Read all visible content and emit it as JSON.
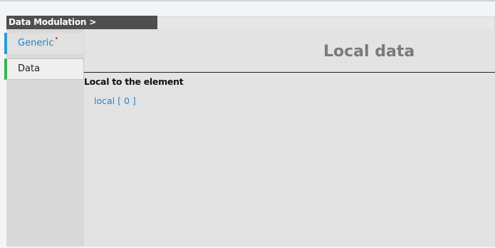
{
  "header": {
    "title": "Data Modulation >"
  },
  "sidebar": {
    "items": [
      {
        "label": "Generic",
        "required_mark": "•"
      },
      {
        "label": "Data"
      }
    ]
  },
  "main": {
    "title": "Local data",
    "section_label": "Local to the element",
    "link_text": "local [ 0 ]"
  },
  "colors": {
    "accent_blue": "#2a83c5",
    "generic_marker": "#2a9bd8",
    "data_marker": "#3cb34a",
    "required_red": "#e22929",
    "header_bg": "#4f4f4f"
  }
}
